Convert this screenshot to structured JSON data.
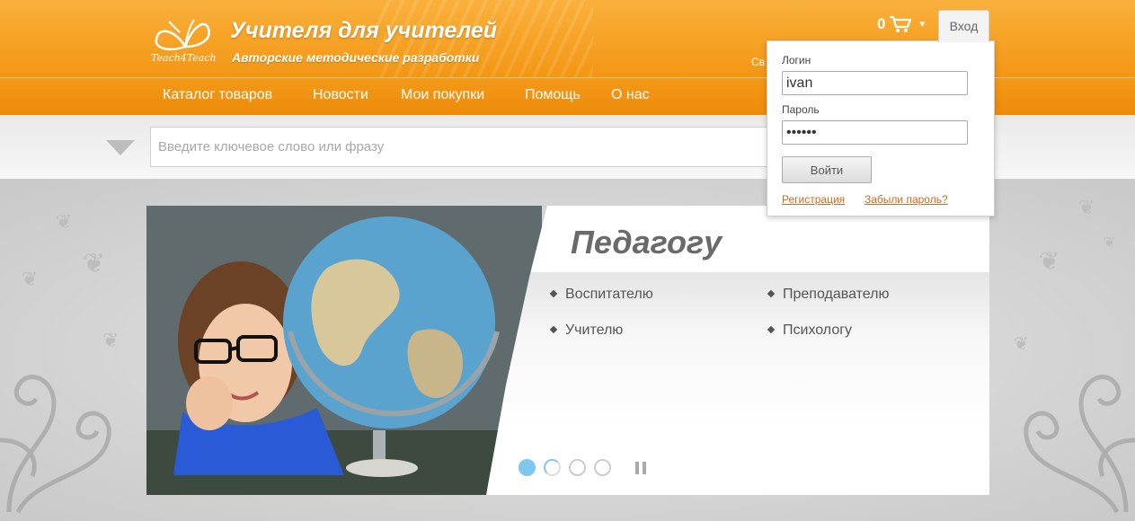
{
  "header": {
    "logo_text": "Teach4Teach",
    "title": "Учителя для учителей",
    "subtitle": "Авторские методические разработки",
    "cart_count": "0",
    "contact_hint": "Св",
    "login_tab": "Вход"
  },
  "nav": {
    "items": [
      {
        "label": "Каталог товаров"
      },
      {
        "label": "Новости"
      },
      {
        "label": "Мои покупки"
      },
      {
        "label": "Помощь"
      },
      {
        "label": "О нас"
      }
    ]
  },
  "search": {
    "placeholder": "Введите ключевое слово или фразу"
  },
  "login_panel": {
    "login_label": "Логин",
    "login_value": "ivan",
    "password_label": "Пароль",
    "password_value": "••••••",
    "submit_label": "Войти",
    "register_link": "Регистрация",
    "forgot_link": "Забыли пароль?"
  },
  "slider": {
    "title": "Педагогу",
    "links": [
      {
        "label": "Воспитателю"
      },
      {
        "label": "Преподавателю"
      },
      {
        "label": "Учителю"
      },
      {
        "label": "Психологу"
      }
    ],
    "slide_count": 4,
    "active_slide": 1
  },
  "colors": {
    "header_orange": "#f6a225",
    "nav_orange": "#ef8a0b",
    "link_orange": "#d2691e",
    "dot_active": "#7ec8f0"
  }
}
